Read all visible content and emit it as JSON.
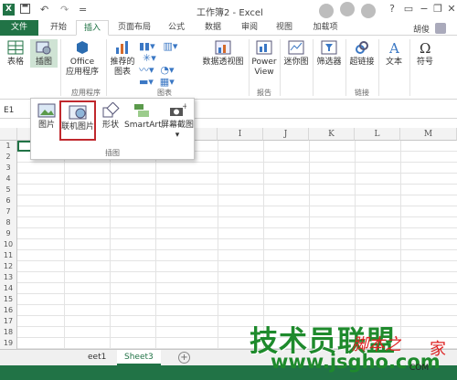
{
  "window": {
    "title": "工作簿2 - Excel",
    "user": "胡俊",
    "help": "?",
    "minimize": "−",
    "restore": "❐",
    "close": "✕"
  },
  "quick_access": {
    "save": "💾",
    "undo": "↶",
    "redo": "↷",
    "customize": "="
  },
  "tabs": [
    "文件",
    "开始",
    "插入",
    "页面布局",
    "公式",
    "数据",
    "审阅",
    "视图",
    "加载项"
  ],
  "ribbon": {
    "table": "表格",
    "illustrations": "插图",
    "office_apps": "Office\n应用程序",
    "apps_group": "应用程序",
    "recommended_charts": "推荐的\n图表",
    "charts_group": "图表",
    "pivot_chart": "数据透视图",
    "power_view": "Power\nView",
    "reports_group": "报告",
    "sparklines": "迷你图",
    "filters": "筛选器",
    "hyperlink": "超链接",
    "links_group": "链接",
    "text": "文本",
    "symbols": "符号"
  },
  "formula_bar": {
    "name_box": "E1"
  },
  "illustrations_dropdown": {
    "items": [
      "图片",
      "联机图片",
      "形状",
      "SmartArt",
      "屏幕截图"
    ],
    "group_label": "插图"
  },
  "columns": [
    "I",
    "J",
    "K",
    "L",
    "M"
  ],
  "rows": [
    "1",
    "2",
    "3",
    "4",
    "5",
    "6",
    "7",
    "8",
    "9",
    "10",
    "11",
    "12",
    "13",
    "14",
    "15",
    "16",
    "17",
    "18",
    "19"
  ],
  "sheets": [
    "eet1",
    "Sheet3"
  ],
  "add_sheet": "⊕",
  "watermark": {
    "brand": "技术员联盟",
    "url": "www.jsgho.com",
    "script": "脚本之",
    "script2": "家",
    "site": "COM"
  },
  "colors": {
    "excel_green": "#217346",
    "highlight_red": "#c0282d",
    "watermark_green": "#1e8a2c"
  }
}
